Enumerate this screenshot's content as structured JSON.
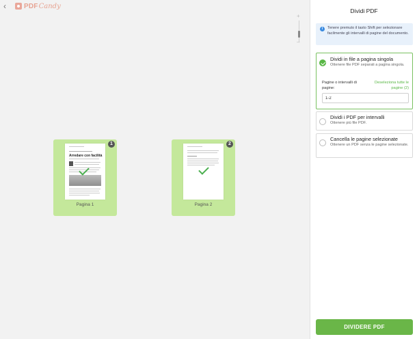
{
  "header": {
    "logo_text": "PDF",
    "logo_text2": "Candy"
  },
  "pages": [
    {
      "number": "1",
      "label": "Pagina 1",
      "thumb_title": "Arredare con facilità"
    },
    {
      "number": "2",
      "label": "Pagina 2"
    }
  ],
  "panel": {
    "title": "Dividi PDF",
    "info": "Tenere premuto il tasto Shift per selezionare facilmente gli intervalli di pagine del documento.",
    "options": [
      {
        "title": "Dividi in file a pagina singola",
        "desc": "Ottenere file PDF separati a pagina singola.",
        "selected": true
      },
      {
        "title": "Dividi i PDF per intervalli",
        "desc": "Ottenere più file PDF.",
        "selected": false
      },
      {
        "title": "Cancella le pagine selezionate",
        "desc": "Ottenere un PDF senza le pagine selezionate.",
        "selected": false
      }
    ],
    "range_label": "Pagine o intervalli di pagine:",
    "deselect_label": "Deseleziona tutte le pagine (2)",
    "range_value": "1-2",
    "split_button": "DIVIDERE PDF"
  },
  "colors": {
    "accent": "#6ab648",
    "card": "#c4e89b",
    "info_bg": "#e8f1fb"
  }
}
